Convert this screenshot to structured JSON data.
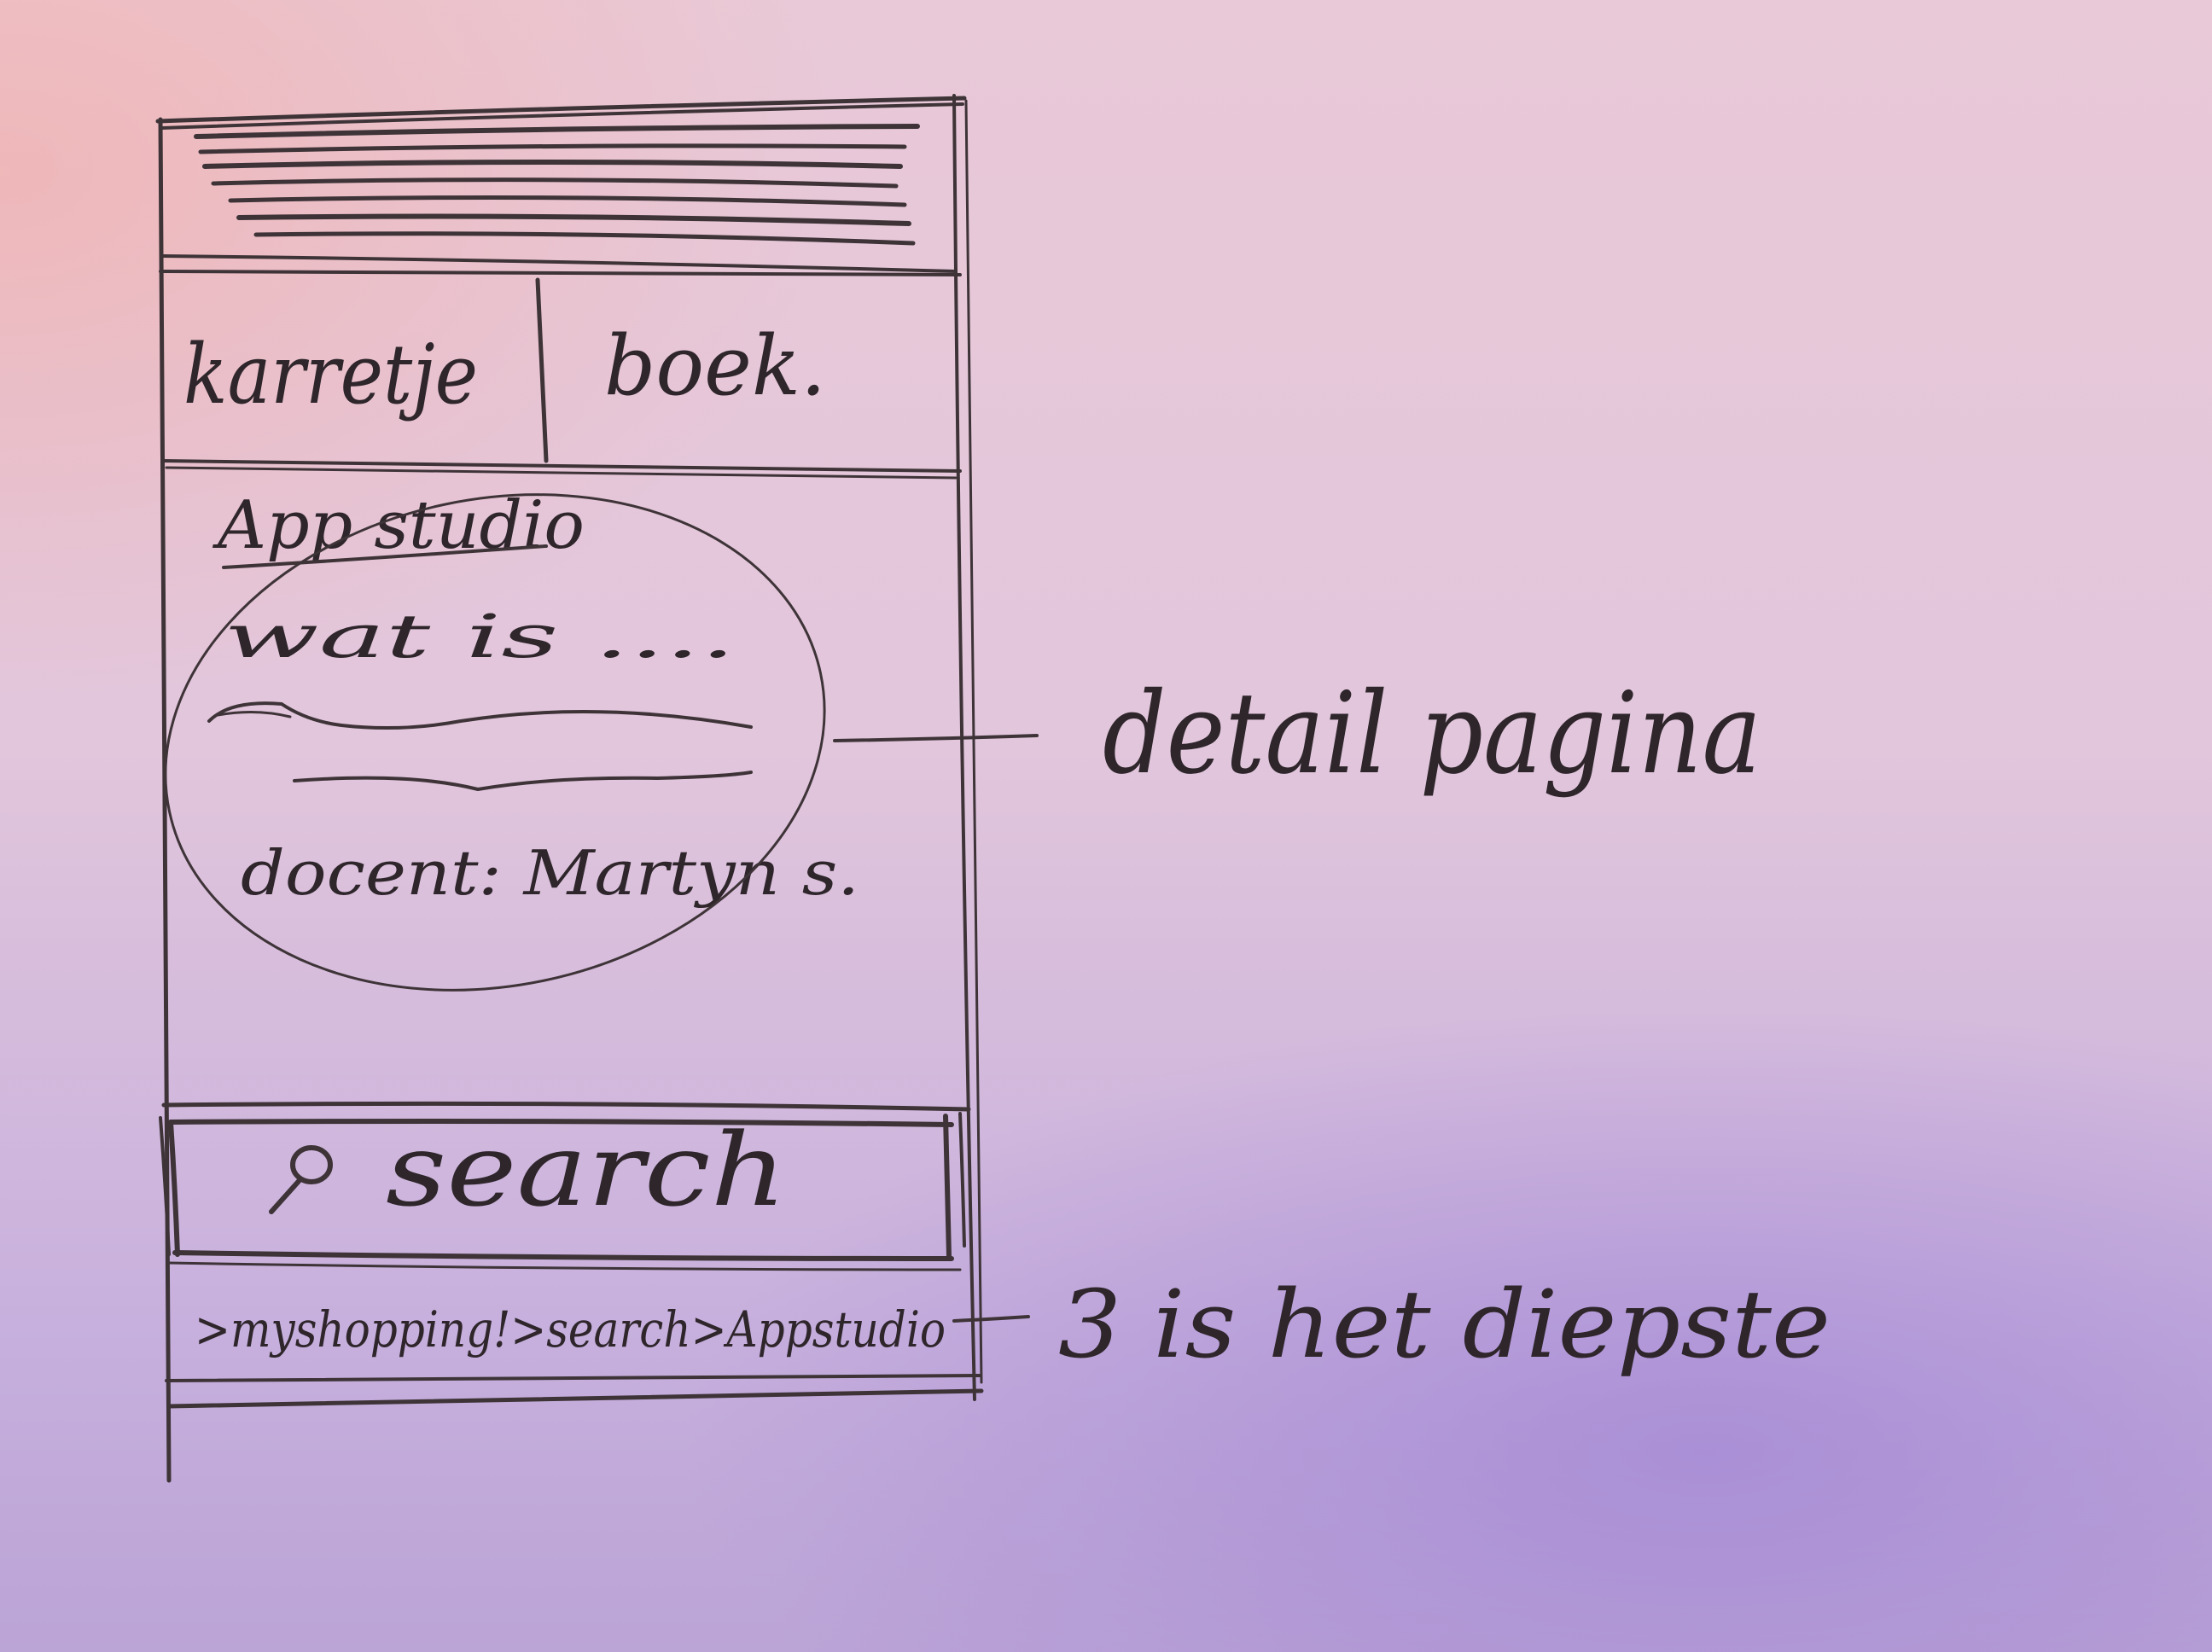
{
  "phone_mockup": {
    "tabs": [
      "karretje",
      "boek."
    ],
    "detail": {
      "title": "App studio",
      "body": "wat is ....",
      "teacher": "docent: Martyn s."
    },
    "search_bar": {
      "label": "search",
      "icon": "magnifier-icon"
    },
    "breadcrumb": ">myshopping!>search>Appstudio"
  },
  "annotations": {
    "detail_callout": "detail pagina",
    "breadcrumb_callout": "3 is het diepste"
  }
}
